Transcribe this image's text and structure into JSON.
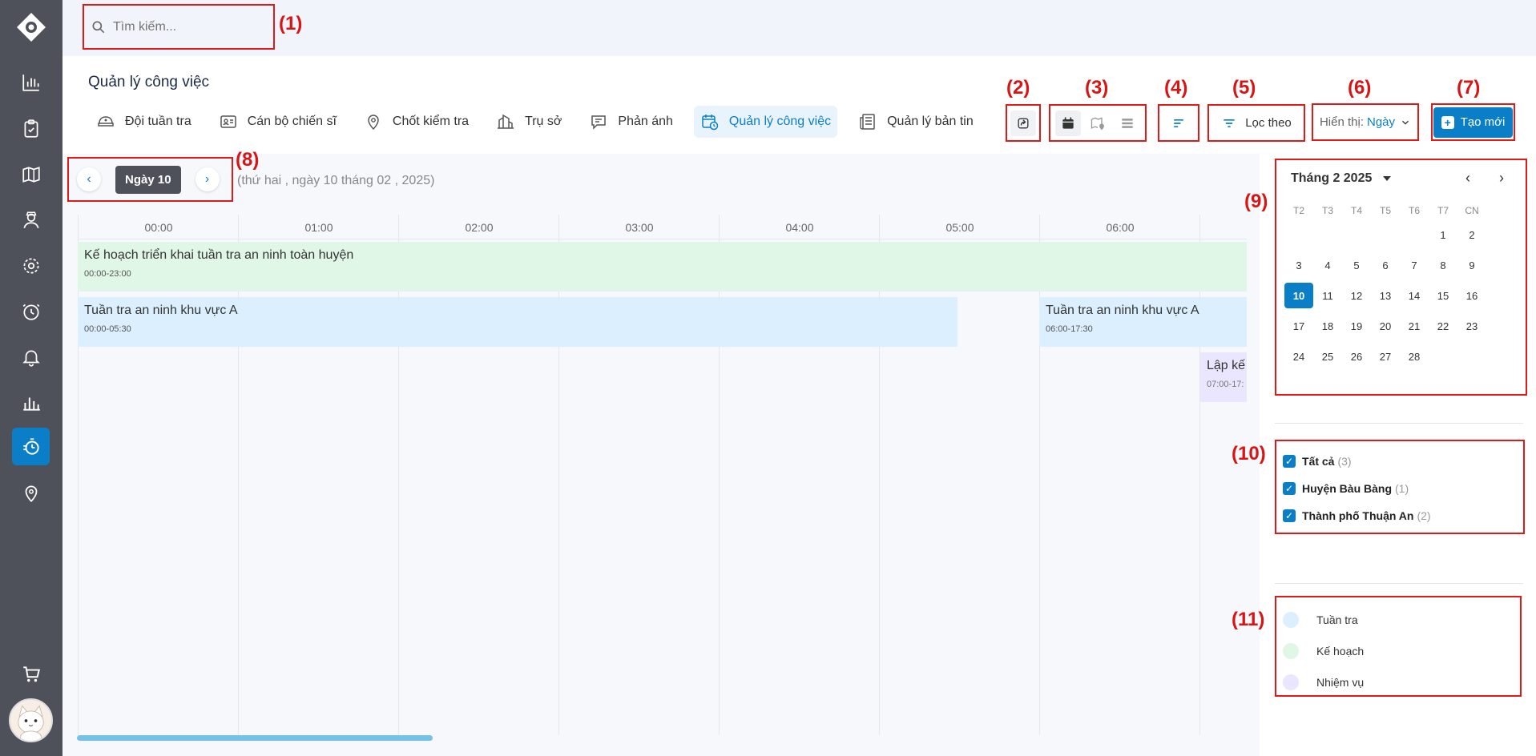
{
  "search": {
    "placeholder": "Tìm kiếm..."
  },
  "annotations": [
    "(1)",
    "(2)",
    "(3)",
    "(4)",
    "(5)",
    "(6)",
    "(7)",
    "(8)",
    "(9)",
    "(10)",
    "(11)"
  ],
  "page": {
    "title": "Quản lý công việc"
  },
  "tabs": [
    {
      "label": "Đội tuần tra",
      "icon": "patrol-hat-icon"
    },
    {
      "label": "Cán bộ chiến sĩ",
      "icon": "id-card-icon"
    },
    {
      "label": "Chốt kiểm tra",
      "icon": "location-pin-icon"
    },
    {
      "label": "Trụ sở",
      "icon": "building-icon"
    },
    {
      "label": "Phản ánh",
      "icon": "chat-icon"
    },
    {
      "label": "Quản lý công việc",
      "icon": "calendar-clock-icon",
      "active": true
    },
    {
      "label": "Quản lý bản tin",
      "icon": "newspaper-icon"
    }
  ],
  "toolbar": {
    "filter_label": "Lọc theo",
    "display_label": "Hiển thị:",
    "display_value": "Ngày",
    "create_label": "Tạo mới"
  },
  "day_nav": {
    "prev": "‹",
    "next": "›",
    "current": "Ngày 10",
    "full_date": "(thứ hai , ngày 10 tháng 02 , 2025)"
  },
  "timeline": {
    "hours": [
      "00:00",
      "01:00",
      "02:00",
      "03:00",
      "04:00",
      "05:00",
      "06:00"
    ],
    "events": [
      {
        "title": "Kế hoạch triển khai tuần tra an ninh toàn huyện",
        "time": "00:00-23:00",
        "type": "plan"
      },
      {
        "title": "Tuần tra an ninh khu vực A",
        "time": "00:00-05:30",
        "type": "patrol"
      },
      {
        "title": "Tuần tra an ninh khu vực A",
        "time": "06:00-17:30",
        "type": "patrol"
      },
      {
        "title": "Lập kế",
        "time": "07:00-17:",
        "type": "task"
      }
    ]
  },
  "calendar": {
    "month_label": "Tháng 2 2025",
    "prev": "‹",
    "next": "›",
    "weekdays": [
      "T2",
      "T3",
      "T4",
      "T5",
      "T6",
      "T7",
      "CN"
    ],
    "weeks": [
      [
        "",
        "",
        "",
        "",
        "",
        "1",
        "2"
      ],
      [
        "3",
        "4",
        "5",
        "6",
        "7",
        "8",
        "9"
      ],
      [
        "10",
        "11",
        "12",
        "13",
        "14",
        "15",
        "16"
      ],
      [
        "17",
        "18",
        "19",
        "20",
        "21",
        "22",
        "23"
      ],
      [
        "24",
        "25",
        "26",
        "27",
        "28",
        "",
        ""
      ]
    ],
    "selected": "10"
  },
  "filters": [
    {
      "label": "Tất cả",
      "count": "(3)"
    },
    {
      "label": "Huyện Bàu Bàng",
      "count": "(1)"
    },
    {
      "label": "Thành phố Thuận An",
      "count": "(2)"
    }
  ],
  "legend": [
    {
      "label": "Tuần tra",
      "color": "#dcefff"
    },
    {
      "label": "Kế hoạch",
      "color": "#e0f6e6"
    },
    {
      "label": "Nhiệm vụ",
      "color": "#ebe6ff"
    }
  ],
  "colors": {
    "accent": "#0a7fc8",
    "annotation": "#e01919",
    "sidebar": "#4e5159"
  }
}
